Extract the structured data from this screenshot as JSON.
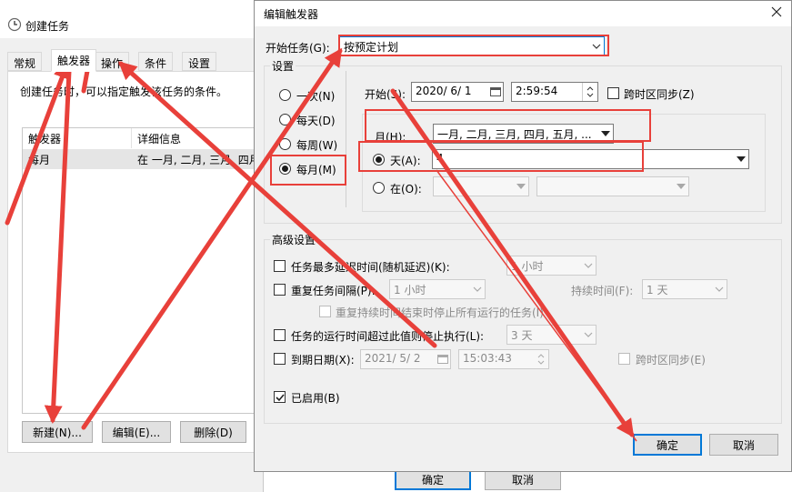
{
  "background_window": {
    "title": "创建任务",
    "tabs": [
      "常规",
      "触发器",
      "操作",
      "条件",
      "设置"
    ],
    "active_tab": "触发器",
    "description": "创建任务时，可以指定触发该任务的条件。",
    "columns": [
      "触发器",
      "详细信息"
    ],
    "rows": [
      {
        "trigger": "每月",
        "details": "在 一月, 二月, 三月, 四月"
      }
    ],
    "buttons": {
      "new": "新建(N)...",
      "edit": "编辑(E)...",
      "delete": "删除(D)"
    },
    "bottom": {
      "ok": "确定",
      "cancel": "取消"
    }
  },
  "dialog": {
    "title": "编辑触发器",
    "begin_task_label": "开始任务(G):",
    "begin_task_value": "按预定计划",
    "settings_label": "设置",
    "schedule_options": [
      "一次(N)",
      "每天(D)",
      "每周(W)",
      "每月(M)"
    ],
    "selected_schedule": "每月(M)",
    "start_label": "开始(S):",
    "start_date": "2020/ 6/ 1",
    "start_time": "2:59:54",
    "sync_tz_label": "跨时区同步(Z)",
    "month_label": "月(H):",
    "month_value": "一月, 二月, 三月, 四月, 五月, ...",
    "day_label": "天(A):",
    "day_value": "4",
    "on_label": "在(O):",
    "advanced_label": "高级设置",
    "delay_label": "任务最多延迟时间(随机延迟)(K):",
    "delay_value": "1 小时",
    "repeat_label": "重复任务间隔(P):",
    "repeat_value": "1 小时",
    "duration_label": "持续时间(F):",
    "duration_value": "1 天",
    "stop_repeat_label": "重复持续时间结束时停止所有运行的任务(I)",
    "stop_if_label": "任务的运行时间超过此值则停止执行(L):",
    "stop_if_value": "3 天",
    "expire_label": "到期日期(X):",
    "expire_date": "2021/ 5/ 2",
    "expire_time": "15:03:43",
    "expire_sync_label": "跨时区同步(E)",
    "enabled_label": "已启用(B)",
    "ok": "确定",
    "cancel": "取消"
  },
  "colors": {
    "annotation_red": "#e8403a",
    "accent": "#0078d7"
  }
}
